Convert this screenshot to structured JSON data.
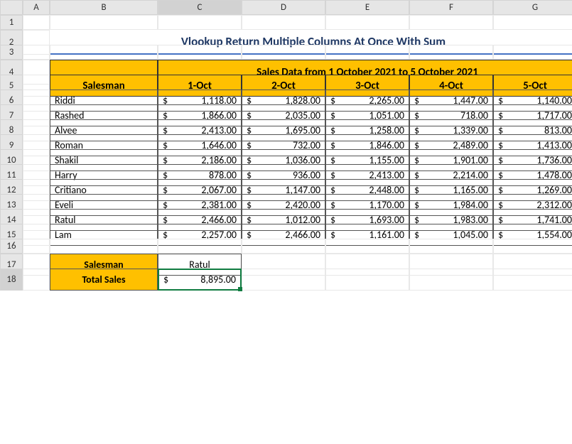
{
  "columns": [
    "A",
    "B",
    "C",
    "D",
    "E",
    "F",
    "G"
  ],
  "rows": [
    "1",
    "2",
    "3",
    "4",
    "5",
    "6",
    "7",
    "8",
    "9",
    "10",
    "11",
    "12",
    "13",
    "14",
    "15",
    "16",
    "17",
    "18"
  ],
  "title": "Vlookup Return Multiple Columns At Once With Sum",
  "sales_header": "Sales Data from 1 October 2021 to 5 October 2021",
  "headers": {
    "salesman": "Salesman",
    "dates": [
      "1-Oct",
      "2-Oct",
      "3-Oct",
      "4-Oct",
      "5-Oct"
    ]
  },
  "salesmen": [
    "Riddi",
    "Rashed",
    "Alvee",
    "Roman",
    "Shakil",
    "Harry",
    "Critiano",
    "Eveli",
    "Ratul",
    "Lam"
  ],
  "chart_data": {
    "type": "table",
    "title": "Sales Data from 1 October 2021 to 5 October 2021",
    "categories": [
      "1-Oct",
      "2-Oct",
      "3-Oct",
      "4-Oct",
      "5-Oct"
    ],
    "series": [
      {
        "name": "Riddi",
        "values": [
          1118.0,
          1828.0,
          2265.0,
          1447.0,
          1140.0
        ]
      },
      {
        "name": "Rashed",
        "values": [
          1866.0,
          2035.0,
          1051.0,
          718.0,
          1717.0
        ]
      },
      {
        "name": "Alvee",
        "values": [
          2413.0,
          1695.0,
          1258.0,
          1339.0,
          813.0
        ]
      },
      {
        "name": "Roman",
        "values": [
          1646.0,
          732.0,
          1846.0,
          2489.0,
          1413.0
        ]
      },
      {
        "name": "Shakil",
        "values": [
          2186.0,
          1036.0,
          1155.0,
          1901.0,
          1736.0
        ]
      },
      {
        "name": "Harry",
        "values": [
          878.0,
          936.0,
          2413.0,
          2214.0,
          1478.0
        ]
      },
      {
        "name": "Critiano",
        "values": [
          2067.0,
          1147.0,
          2448.0,
          1165.0,
          1269.0
        ]
      },
      {
        "name": "Eveli",
        "values": [
          2381.0,
          2420.0,
          1170.0,
          1984.0,
          2312.0
        ]
      },
      {
        "name": "Ratul",
        "values": [
          2466.0,
          1012.0,
          1693.0,
          1983.0,
          1741.0
        ]
      },
      {
        "name": "Lam",
        "values": [
          2257.0,
          2466.0,
          1161.0,
          1045.0,
          1554.0
        ]
      }
    ]
  },
  "data_formatted": [
    [
      "1,118.00",
      "1,828.00",
      "2,265.00",
      "1,447.00",
      "1,140.00"
    ],
    [
      "1,866.00",
      "2,035.00",
      "1,051.00",
      "718.00",
      "1,717.00"
    ],
    [
      "2,413.00",
      "1,695.00",
      "1,258.00",
      "1,339.00",
      "813.00"
    ],
    [
      "1,646.00",
      "732.00",
      "1,846.00",
      "2,489.00",
      "1,413.00"
    ],
    [
      "2,186.00",
      "1,036.00",
      "1,155.00",
      "1,901.00",
      "1,736.00"
    ],
    [
      "878.00",
      "936.00",
      "2,413.00",
      "2,214.00",
      "1,478.00"
    ],
    [
      "2,067.00",
      "1,147.00",
      "2,448.00",
      "1,165.00",
      "1,269.00"
    ],
    [
      "2,381.00",
      "2,420.00",
      "1,170.00",
      "1,984.00",
      "2,312.00"
    ],
    [
      "2,466.00",
      "1,012.00",
      "1,693.00",
      "1,983.00",
      "1,741.00"
    ],
    [
      "2,257.00",
      "2,466.00",
      "1,161.00",
      "1,045.00",
      "1,554.00"
    ]
  ],
  "lookup": {
    "salesman_label": "Salesman",
    "salesman_value": "Ratul",
    "total_label": "Total Sales",
    "total_value": "8,895.00"
  },
  "currency": "$",
  "selected_col": "C",
  "selected_row": "18"
}
